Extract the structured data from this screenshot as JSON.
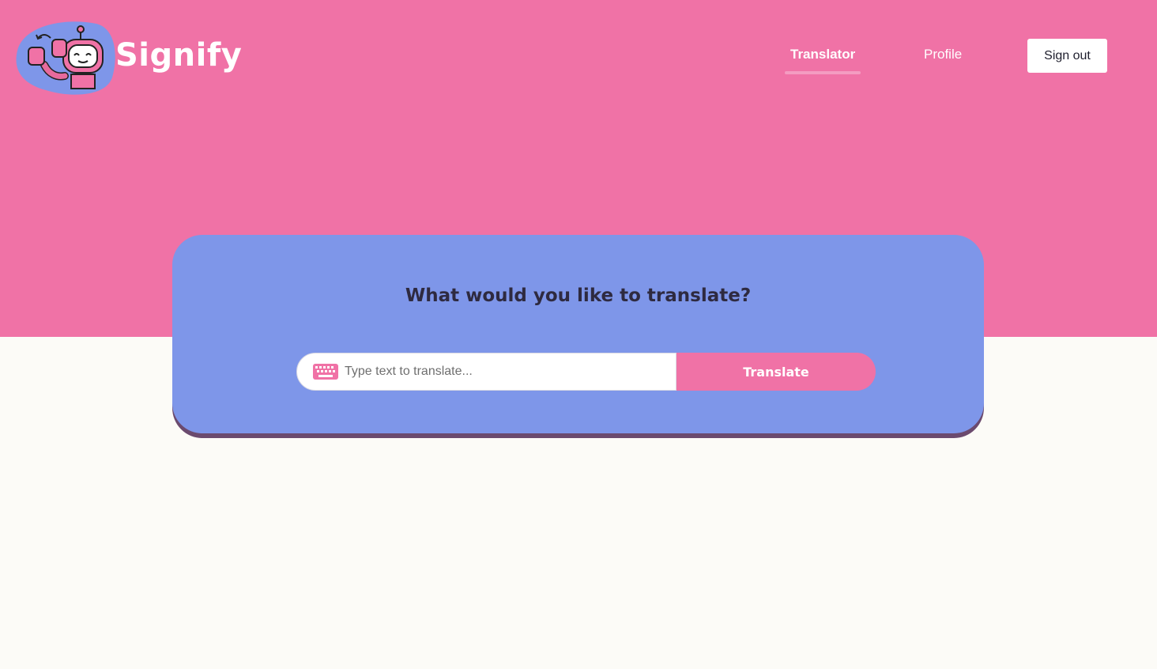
{
  "app": {
    "name": "Signify",
    "logo_icon": "robot-signing-icon"
  },
  "nav": {
    "translator_label": "Translator",
    "profile_label": "Profile",
    "signout_label": "Sign out",
    "active": "Translator"
  },
  "translator": {
    "heading": "What would you like to translate?",
    "input_value": "",
    "input_placeholder": "Type text to translate...",
    "input_icon": "keyboard-icon",
    "button_label": "Translate"
  },
  "colors": {
    "hero": "#f072a6",
    "card": "#7e96e9",
    "page_background": "#fcfbf7",
    "accent": "#f072a6"
  }
}
